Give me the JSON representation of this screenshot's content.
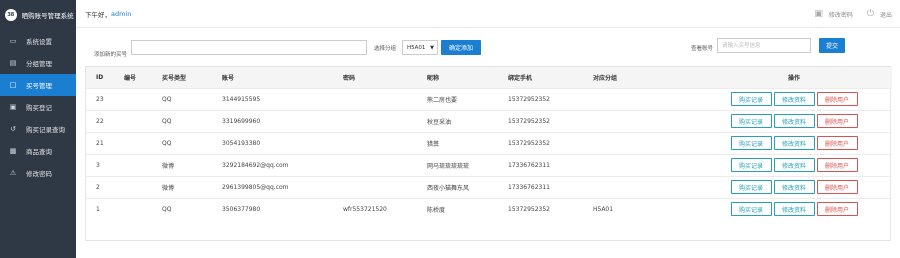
{
  "brand": {
    "logo_text": "38",
    "title": "晒购账号管理系统"
  },
  "sidebar": {
    "items": [
      {
        "label": "系统设置",
        "icon": "monitor-icon",
        "active": false
      },
      {
        "label": "分组管理",
        "icon": "folder-icon",
        "active": false
      },
      {
        "label": "买号管理",
        "icon": "document-icon",
        "active": true
      },
      {
        "label": "购买登记",
        "icon": "register-icon",
        "active": false
      },
      {
        "label": "购买记录查询",
        "icon": "history-icon",
        "active": false
      },
      {
        "label": "商品查询",
        "icon": "box-icon",
        "active": false
      },
      {
        "label": "修改密码",
        "icon": "warning-icon",
        "active": false
      }
    ]
  },
  "header": {
    "greeting": "下午好，",
    "username": "admin",
    "change_password": "修改密码",
    "logout": "退出"
  },
  "toolbar": {
    "add_label": "添加新的买号",
    "add_value": "",
    "group_label": "选择分组",
    "group_selected": "H5A01",
    "confirm_add": "确定添加",
    "search_label": "查看账号",
    "search_placeholder": "请输入买号信息",
    "submit": "提交"
  },
  "table": {
    "columns": [
      "ID",
      "编号",
      "买号类型",
      "账号",
      "密码",
      "昵称",
      "绑定手机",
      "对应分组",
      "操作"
    ],
    "actions": {
      "purchase_record": "购买记录",
      "edit": "修改资料",
      "delete": "删除用户"
    },
    "rows": [
      {
        "id": "23",
        "number": "",
        "type": "QQ",
        "account": "3144915595",
        "password": "",
        "nickname": "熊二房也要",
        "phone": "15372952352",
        "group": ""
      },
      {
        "id": "22",
        "number": "",
        "type": "QQ",
        "account": "3319699960",
        "password": "",
        "nickname": "秋豆采油",
        "phone": "15372952352",
        "group": ""
      },
      {
        "id": "21",
        "number": "",
        "type": "QQ",
        "account": "3054193380",
        "password": "",
        "nickname": "猎粪",
        "phone": "15372952352",
        "group": ""
      },
      {
        "id": "3",
        "number": "",
        "type": "微博",
        "account": "3292184692@qq.com",
        "password": "",
        "nickname": "网马琉琉琉琉琉",
        "phone": "17336762311",
        "group": ""
      },
      {
        "id": "2",
        "number": "",
        "type": "微博",
        "account": "2961399805@qq.com",
        "password": "",
        "nickname": "西夜小猫舞东风",
        "phone": "17336762311",
        "group": ""
      },
      {
        "id": "1",
        "number": "",
        "type": "QQ",
        "account": "3506377980",
        "password": "wfr553721520",
        "nickname": "陈桥度",
        "phone": "15372952352",
        "group": "H5A01"
      }
    ]
  },
  "colors": {
    "sidebar_bg": "#2f3945",
    "accent": "#1b7fd1",
    "teal": "#25a0b8",
    "danger": "#d9534f"
  }
}
